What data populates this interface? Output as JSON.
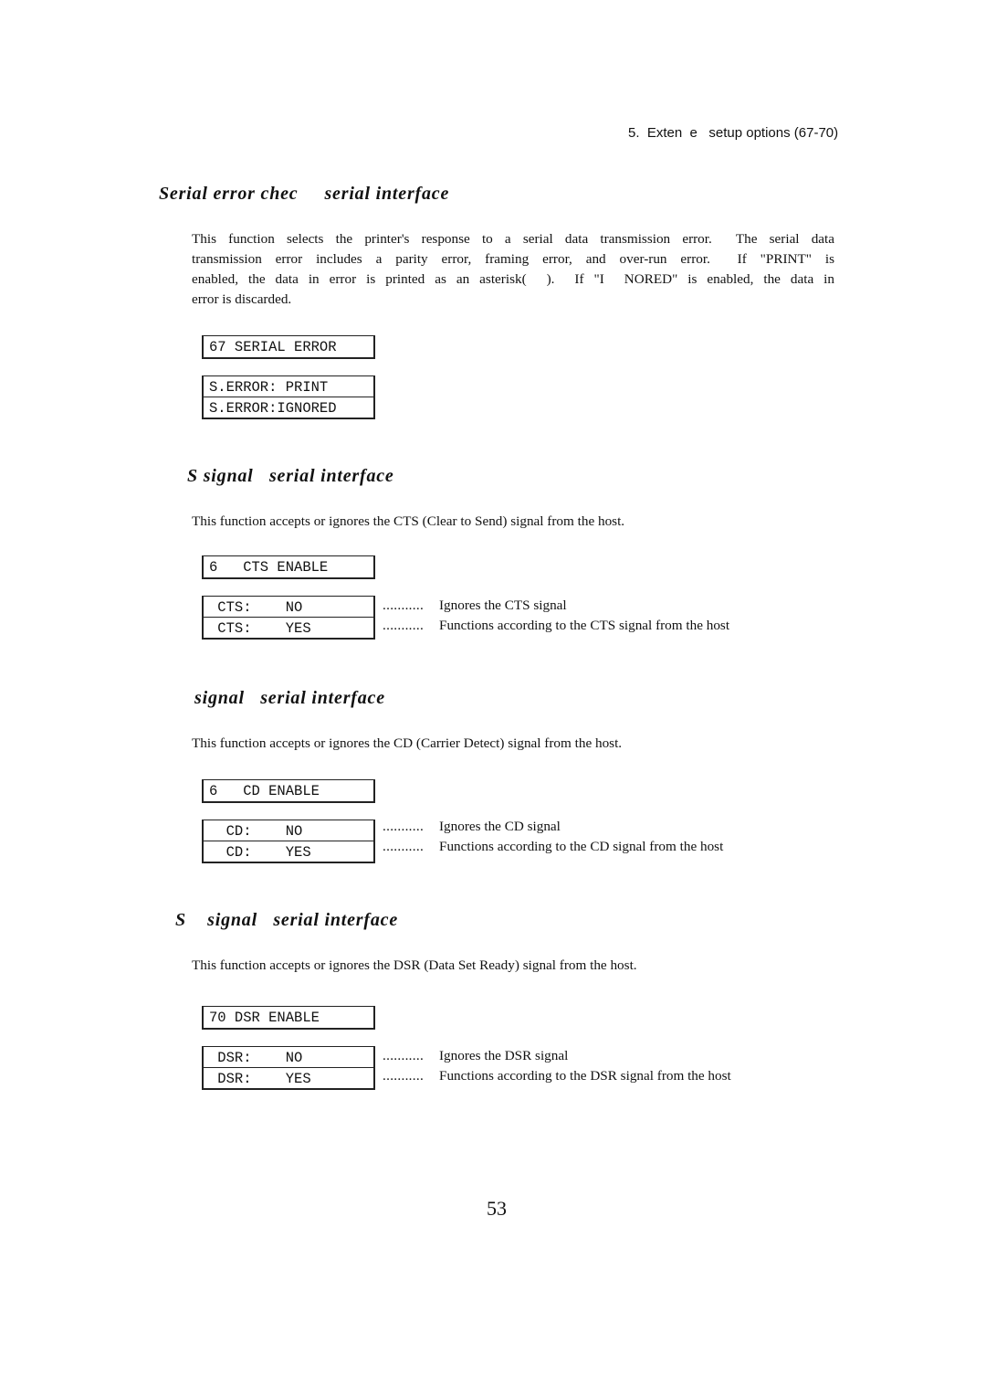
{
  "running_header": "5.  Exten  e   setup options (67-70)",
  "sections": [
    {
      "heading": "Serial error chec     serial interface",
      "paragraph_lines": [
        "This function selects the printer's response to a serial data transmission error.  The serial data",
        "transmission error includes a parity error, framing error, and over-run error.  If \"PRINT\" is",
        "enabled, the data in error is printed as an asterisk(  ).  If \"I  NORED\" is enabled, the data in",
        "error is discarded."
      ],
      "menu_title": "67 SERIAL ERROR",
      "options": [
        {
          "display": "S.ERROR: PRINT",
          "description": ""
        },
        {
          "display": "S.ERROR:IGNORED",
          "description": ""
        }
      ]
    },
    {
      "heading": "S signal   serial interface",
      "paragraph_lines": [
        "This function accepts or ignores the CTS (Clear to Send) signal from the host."
      ],
      "menu_title": "6   CTS ENABLE",
      "options": [
        {
          "display": " CTS:    NO",
          "description": "Ignores the CTS signal"
        },
        {
          "display": " CTS:    YES",
          "description": "Functions according to the CTS signal from the host"
        }
      ]
    },
    {
      "heading": "signal   serial interface",
      "paragraph_lines": [
        "This function accepts or ignores the CD (Carrier Detect) signal from the host."
      ],
      "menu_title": "6   CD ENABLE",
      "options": [
        {
          "display": "  CD:    NO",
          "description": "Ignores the CD signal"
        },
        {
          "display": "  CD:    YES",
          "description": "Functions according to the CD signal from the host"
        }
      ]
    },
    {
      "heading": "S    signal   serial interface",
      "paragraph_lines": [
        "This function accepts or ignores the DSR (Data Set Ready) signal from the host."
      ],
      "menu_title": "70 DSR ENABLE",
      "options": [
        {
          "display": " DSR:    NO",
          "description": "Ignores the DSR signal"
        },
        {
          "display": " DSR:    YES",
          "description": "Functions according to the DSR signal from the host"
        }
      ]
    }
  ],
  "leader_dots": "...........",
  "page_number": "53"
}
